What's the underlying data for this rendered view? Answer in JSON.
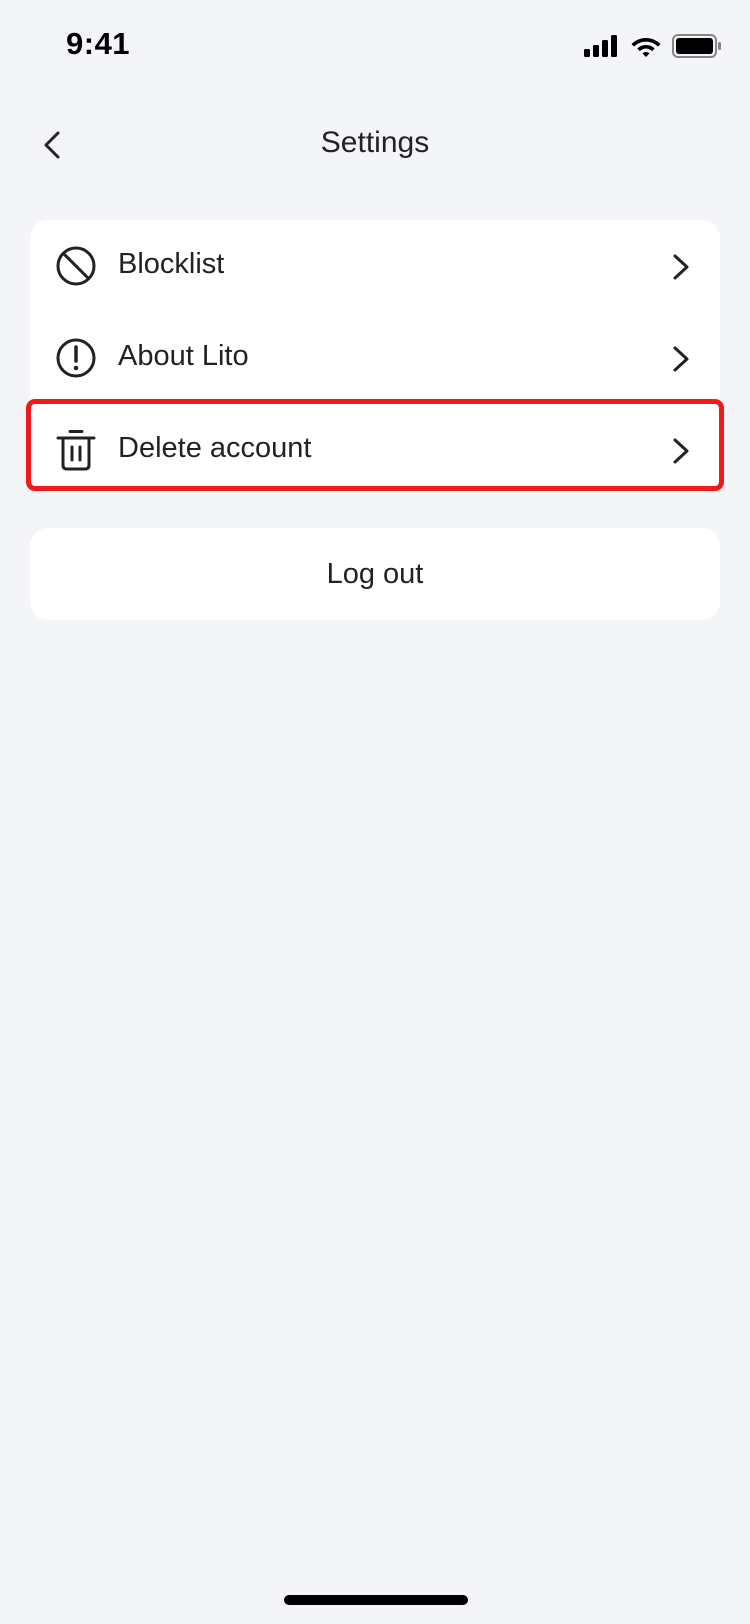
{
  "status_bar": {
    "time": "9:41"
  },
  "nav": {
    "title": "Settings",
    "back_icon": "chevron-left-icon"
  },
  "settings": {
    "items": [
      {
        "label": "Blocklist",
        "icon": "block-icon"
      },
      {
        "label": "About Lito",
        "icon": "info-circle-icon"
      },
      {
        "label": "Delete account",
        "icon": "trash-icon",
        "highlighted": true
      }
    ]
  },
  "logout": {
    "label": "Log out"
  },
  "colors": {
    "background": "#f4f5f9",
    "card": "#ffffff",
    "text": "#222222",
    "highlight": "#ef1a1a"
  }
}
